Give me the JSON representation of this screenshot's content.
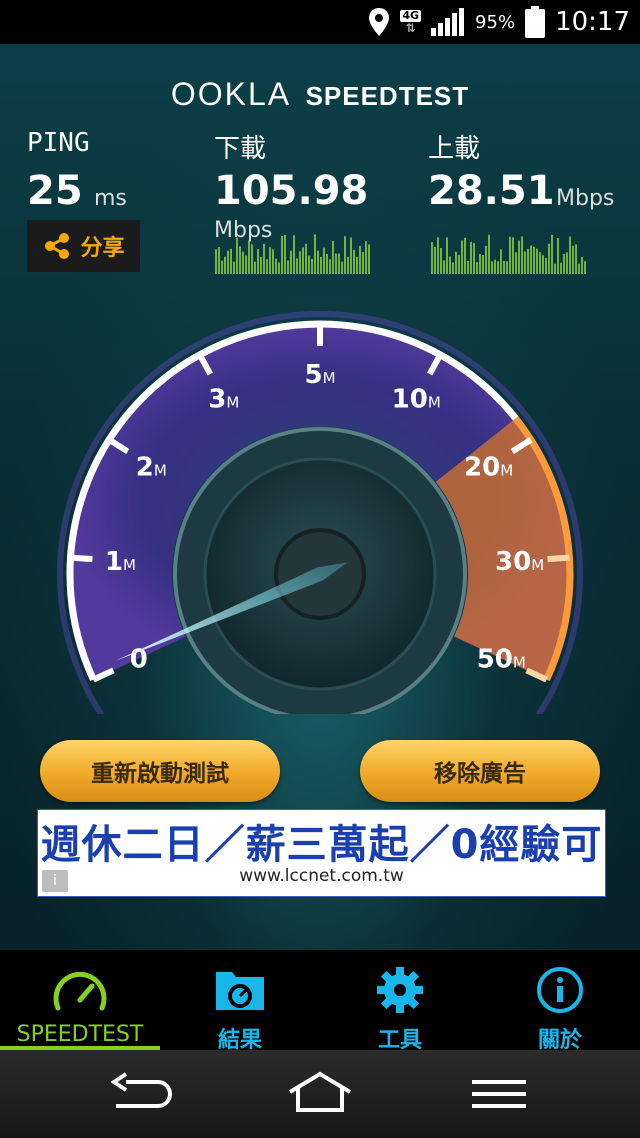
{
  "status_bar": {
    "network_type": "4G",
    "battery_percent": "95%",
    "time": "10:17",
    "icons": [
      "location-pin-icon",
      "signal-icon",
      "battery-icon"
    ]
  },
  "header": {
    "logo_ookla": "OOKLA",
    "logo_speedtest": "SPEEDTEST"
  },
  "results": {
    "ping": {
      "label": "PING",
      "value": "25",
      "unit": "ms"
    },
    "download": {
      "label": "下載",
      "value": "105.98",
      "unit": "Mbps"
    },
    "upload": {
      "label": "上載",
      "value": "28.51",
      "unit": "Mbps"
    }
  },
  "share_button": {
    "label": "分享",
    "icon": "share-icon"
  },
  "gauge": {
    "ticks": [
      {
        "num": "0",
        "unit": ""
      },
      {
        "num": "1",
        "unit": "M"
      },
      {
        "num": "2",
        "unit": "M"
      },
      {
        "num": "3",
        "unit": "M"
      },
      {
        "num": "5",
        "unit": "M"
      },
      {
        "num": "10",
        "unit": "M"
      },
      {
        "num": "20",
        "unit": "M"
      },
      {
        "num": "30",
        "unit": "M"
      },
      {
        "num": "50",
        "unit": "M"
      }
    ],
    "needle_fraction": 0.0
  },
  "buttons": {
    "restart": "重新啟動測試",
    "remove_ads": "移除廣告"
  },
  "ad": {
    "headline": "週休二日／薪三萬起／0經驗可",
    "url": "www.lccnet.com.tw"
  },
  "tabs": [
    {
      "label": "SPEEDTEST",
      "icon": "speedometer-icon",
      "active": true
    },
    {
      "label": "結果",
      "icon": "results-folder-icon",
      "active": false
    },
    {
      "label": "工具",
      "icon": "gear-icon",
      "active": false
    },
    {
      "label": "關於",
      "icon": "info-icon",
      "active": false
    }
  ],
  "nav": [
    "back-icon",
    "home-icon",
    "menu-icon"
  ],
  "colors": {
    "accent_green": "#86d11f",
    "accent_blue": "#18b6ea",
    "button_orange": "#f0a928",
    "gauge_purple": "#8a5cff",
    "gauge_orange": "#ff8a2a"
  }
}
